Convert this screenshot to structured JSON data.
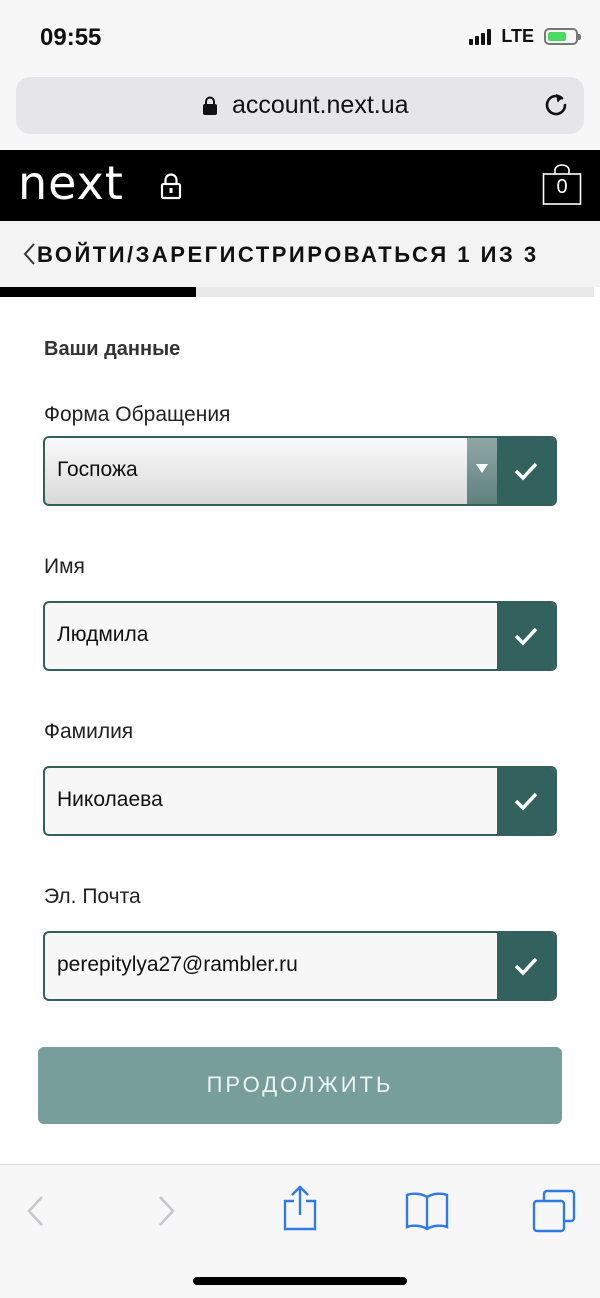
{
  "status_bar": {
    "time": "09:55",
    "network": "LTE"
  },
  "browser": {
    "url": "account.next.ua"
  },
  "header": {
    "logo": "next",
    "bag_count": "0"
  },
  "step": {
    "title": "ВОЙТИ/ЗАРЕГИСТРИРОВАТЬСЯ 1 ИЗ 3",
    "progress": 0.33
  },
  "form": {
    "section_title": "Ваши данные",
    "salutation": {
      "label": "Форма Обращения",
      "value": "Госпожа"
    },
    "first_name": {
      "label": "Имя",
      "value": "Людмила"
    },
    "last_name": {
      "label": "Фамилия",
      "value": "Николаева"
    },
    "email": {
      "label": "Эл. Почта",
      "value": "perepitylya27@rambler.ru"
    },
    "continue_label": "ПРОДОЛЖИТЬ"
  },
  "toolbar": {
    "items": [
      "back-icon",
      "forward-icon",
      "share-icon",
      "bookmarks-icon",
      "tabs-icon"
    ]
  },
  "colors": {
    "accent": "#33615d",
    "button": "#779e9a",
    "header": "#000000"
  }
}
